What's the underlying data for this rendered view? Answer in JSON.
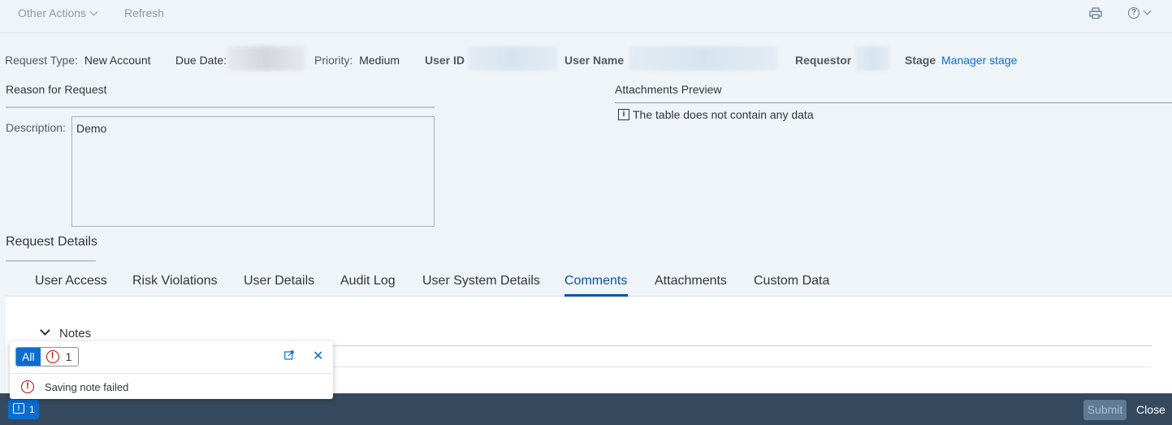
{
  "toolbar": {
    "other_actions": "Other Actions",
    "refresh": "Refresh",
    "print_icon": "printer-icon",
    "help_icon": "help-icon",
    "help_glyph": "?"
  },
  "header": {
    "request_type_label": "Request Type:",
    "request_type_value": "New Account",
    "due_date_label": "Due Date:",
    "priority_label": "Priority:",
    "priority_value": "Medium",
    "user_id_label": "User ID",
    "user_name_label": "User Name",
    "requestor_label": "Requestor",
    "stage_label": "Stage",
    "stage_value": "Manager stage"
  },
  "reason": {
    "title": "Reason for Request",
    "description_label": "Description:",
    "description_value": "Demo"
  },
  "attachments": {
    "title": "Attachments Preview",
    "info_glyph": "i",
    "empty_message": "The table does not contain any data"
  },
  "request_details": {
    "title": "Request Details",
    "tabs": [
      {
        "label": "User Access"
      },
      {
        "label": "Risk Violations"
      },
      {
        "label": "User Details"
      },
      {
        "label": "Audit Log"
      },
      {
        "label": "User System Details"
      },
      {
        "label": "Comments"
      },
      {
        "label": "Attachments"
      },
      {
        "label": "Custom Data"
      }
    ],
    "active_tab": "Comments",
    "notes_title": "Notes"
  },
  "popover": {
    "all_label": "All",
    "error_count": "1",
    "error_glyph": "!",
    "close_glyph": "✕",
    "message": "Saving note failed"
  },
  "footer": {
    "message_count": "1",
    "message_glyph": "!",
    "submit": "Submit",
    "close": "Close"
  },
  "colors": {
    "accent": "#0a6ed1",
    "error": "#bb0000",
    "footer_bg": "#354a5f"
  }
}
